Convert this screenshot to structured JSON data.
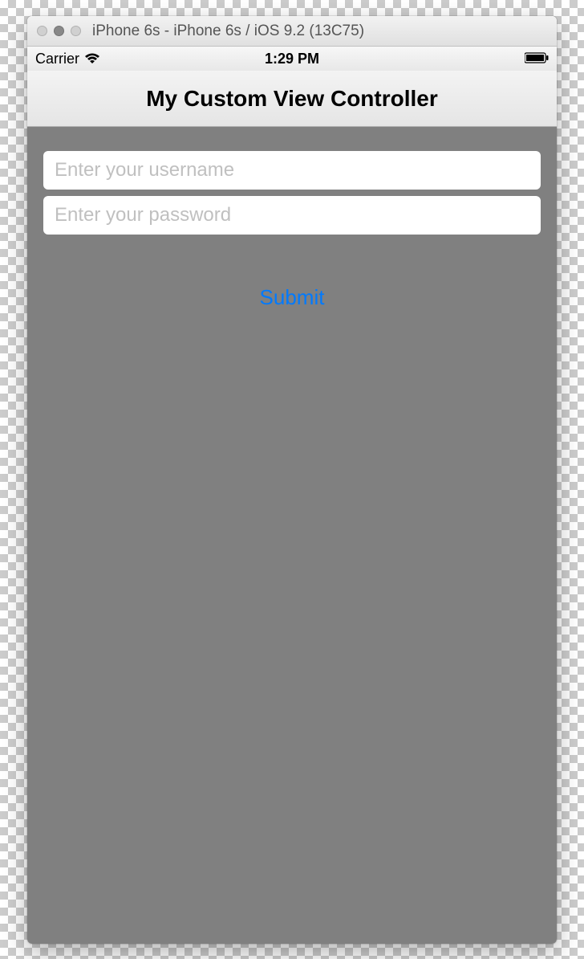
{
  "window": {
    "title": "iPhone 6s - iPhone 6s / iOS 9.2 (13C75)"
  },
  "statusBar": {
    "carrier": "Carrier",
    "time": "1:29 PM"
  },
  "navBar": {
    "title": "My Custom View Controller"
  },
  "form": {
    "usernamePlaceholder": "Enter your username",
    "passwordPlaceholder": "Enter your password",
    "submitLabel": "Submit"
  }
}
